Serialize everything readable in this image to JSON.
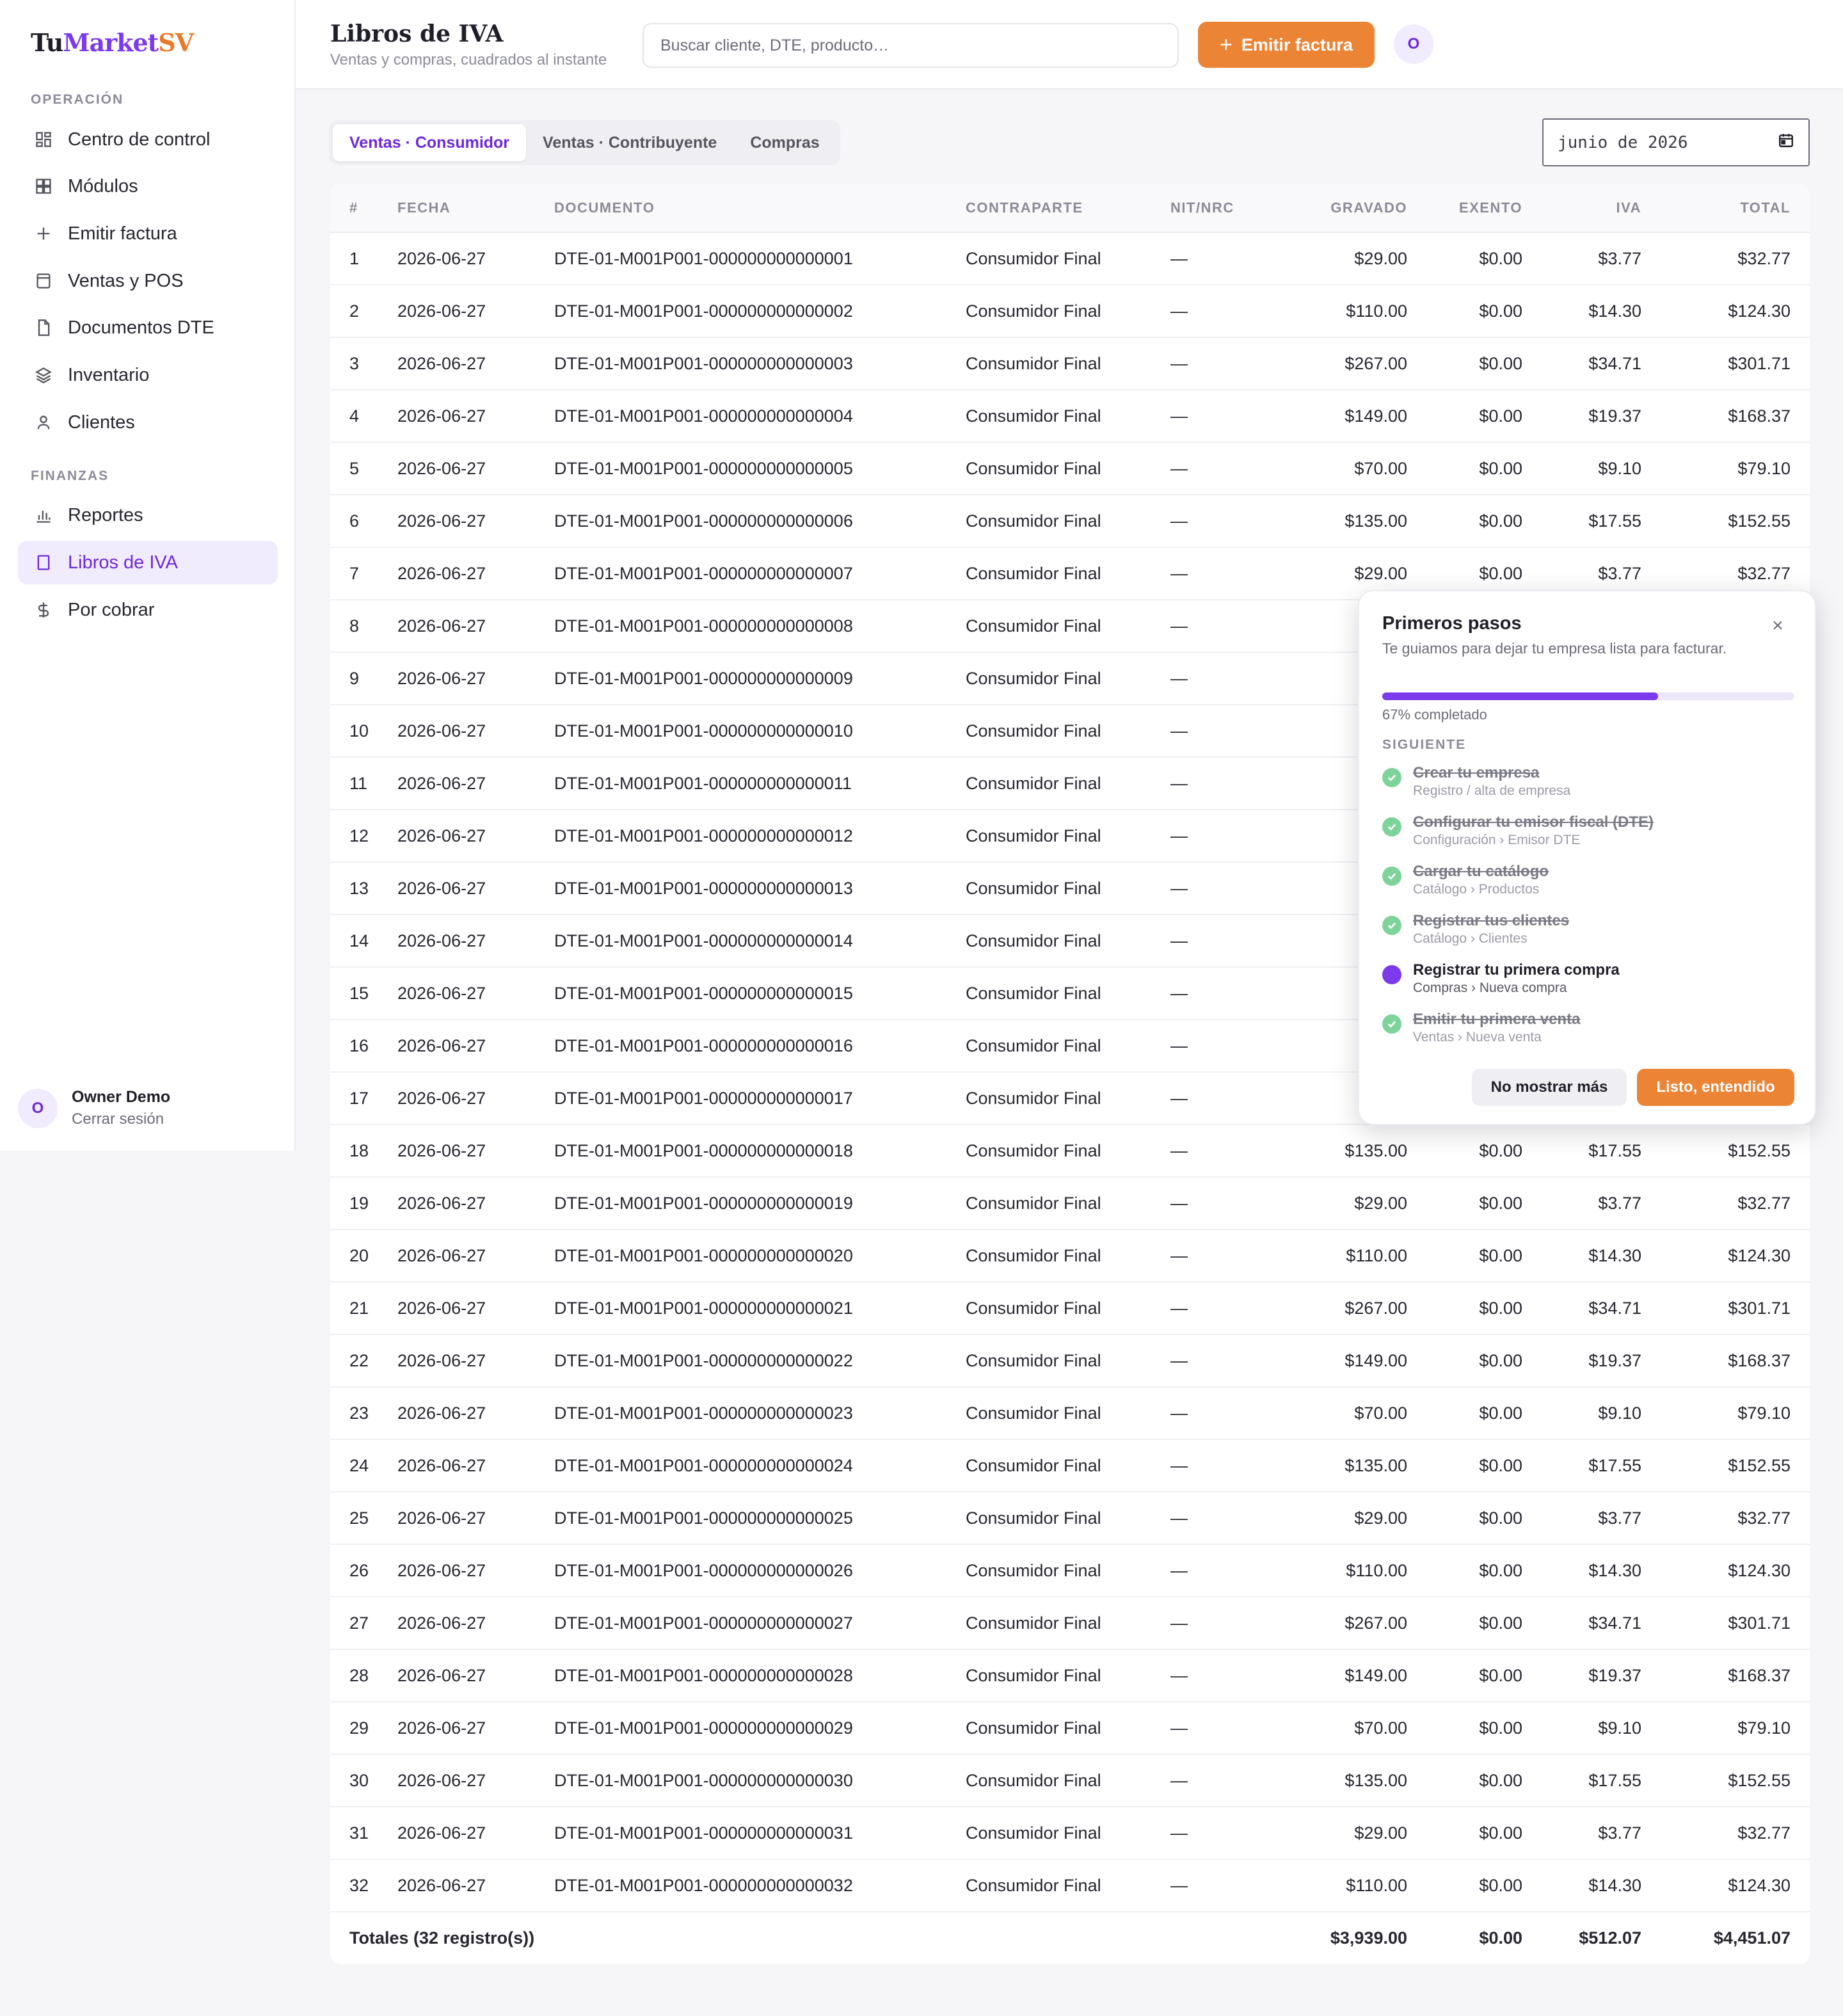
{
  "brand": {
    "part1": "Tu",
    "part2": "Market",
    "part3": "SV"
  },
  "sidebar": {
    "section1": "OPERACIÓN",
    "section2": "FINANZAS",
    "items": [
      {
        "label": "Centro de control",
        "icon": "dashboard-icon"
      },
      {
        "label": "Módulos",
        "icon": "grid-icon"
      },
      {
        "label": "Emitir factura",
        "icon": "plus-icon"
      },
      {
        "label": "Ventas y POS",
        "icon": "register-icon"
      },
      {
        "label": "Documentos DTE",
        "icon": "document-icon"
      },
      {
        "label": "Inventario",
        "icon": "layers-icon"
      },
      {
        "label": "Clientes",
        "icon": "user-icon"
      },
      {
        "label": "Reportes",
        "icon": "bar-chart-icon"
      },
      {
        "label": "Libros de IVA",
        "icon": "book-icon",
        "active": true
      },
      {
        "label": "Por cobrar",
        "icon": "dollar-icon"
      }
    ],
    "user": {
      "initial": "O",
      "name": "Owner Demo",
      "action": "Cerrar sesión"
    }
  },
  "header": {
    "title": "Libros de IVA",
    "subtitle": "Ventas y compras, cuadrados al instante",
    "search_placeholder": "Buscar cliente, DTE, producto…",
    "emit_label": "Emitir factura",
    "avatar_initial": "O"
  },
  "tabs": [
    {
      "label": "Ventas · Consumidor",
      "active": true
    },
    {
      "label": "Ventas · Contribuyente",
      "active": false
    },
    {
      "label": "Compras",
      "active": false
    }
  ],
  "period": "junio de 2026",
  "table": {
    "columns": [
      "#",
      "FECHA",
      "DOCUMENTO",
      "CONTRAPARTE",
      "NIT/NRC",
      "GRAVADO",
      "EXENTO",
      "IVA",
      "TOTAL"
    ],
    "rows": [
      [
        "1",
        "2026-06-27",
        "DTE-01-M001P001-000000000000001",
        "Consumidor Final",
        "—",
        "$29.00",
        "$0.00",
        "$3.77",
        "$32.77"
      ],
      [
        "2",
        "2026-06-27",
        "DTE-01-M001P001-000000000000002",
        "Consumidor Final",
        "—",
        "$110.00",
        "$0.00",
        "$14.30",
        "$124.30"
      ],
      [
        "3",
        "2026-06-27",
        "DTE-01-M001P001-000000000000003",
        "Consumidor Final",
        "—",
        "$267.00",
        "$0.00",
        "$34.71",
        "$301.71"
      ],
      [
        "4",
        "2026-06-27",
        "DTE-01-M001P001-000000000000004",
        "Consumidor Final",
        "—",
        "$149.00",
        "$0.00",
        "$19.37",
        "$168.37"
      ],
      [
        "5",
        "2026-06-27",
        "DTE-01-M001P001-000000000000005",
        "Consumidor Final",
        "—",
        "$70.00",
        "$0.00",
        "$9.10",
        "$79.10"
      ],
      [
        "6",
        "2026-06-27",
        "DTE-01-M001P001-000000000000006",
        "Consumidor Final",
        "—",
        "$135.00",
        "$0.00",
        "$17.55",
        "$152.55"
      ],
      [
        "7",
        "2026-06-27",
        "DTE-01-M001P001-000000000000007",
        "Consumidor Final",
        "—",
        "$29.00",
        "$0.00",
        "$3.77",
        "$32.77"
      ],
      [
        "8",
        "2026-06-27",
        "DTE-01-M001P001-000000000000008",
        "Consumidor Final",
        "—",
        "",
        "",
        "",
        ""
      ],
      [
        "9",
        "2026-06-27",
        "DTE-01-M001P001-000000000000009",
        "Consumidor Final",
        "—",
        "",
        "",
        "",
        ""
      ],
      [
        "10",
        "2026-06-27",
        "DTE-01-M001P001-000000000000010",
        "Consumidor Final",
        "—",
        "",
        "",
        "",
        ""
      ],
      [
        "11",
        "2026-06-27",
        "DTE-01-M001P001-000000000000011",
        "Consumidor Final",
        "—",
        "",
        "",
        "",
        ""
      ],
      [
        "12",
        "2026-06-27",
        "DTE-01-M001P001-000000000000012",
        "Consumidor Final",
        "—",
        "",
        "",
        "",
        ""
      ],
      [
        "13",
        "2026-06-27",
        "DTE-01-M001P001-000000000000013",
        "Consumidor Final",
        "—",
        "",
        "",
        "",
        ""
      ],
      [
        "14",
        "2026-06-27",
        "DTE-01-M001P001-000000000000014",
        "Consumidor Final",
        "—",
        "",
        "",
        "",
        ""
      ],
      [
        "15",
        "2026-06-27",
        "DTE-01-M001P001-000000000000015",
        "Consumidor Final",
        "—",
        "",
        "",
        "",
        ""
      ],
      [
        "16",
        "2026-06-27",
        "DTE-01-M001P001-000000000000016",
        "Consumidor Final",
        "—",
        "",
        "",
        "",
        ""
      ],
      [
        "17",
        "2026-06-27",
        "DTE-01-M001P001-000000000000017",
        "Consumidor Final",
        "—",
        "",
        "",
        "",
        ""
      ],
      [
        "18",
        "2026-06-27",
        "DTE-01-M001P001-000000000000018",
        "Consumidor Final",
        "—",
        "$135.00",
        "$0.00",
        "$17.55",
        "$152.55"
      ],
      [
        "19",
        "2026-06-27",
        "DTE-01-M001P001-000000000000019",
        "Consumidor Final",
        "—",
        "$29.00",
        "$0.00",
        "$3.77",
        "$32.77"
      ],
      [
        "20",
        "2026-06-27",
        "DTE-01-M001P001-000000000000020",
        "Consumidor Final",
        "—",
        "$110.00",
        "$0.00",
        "$14.30",
        "$124.30"
      ],
      [
        "21",
        "2026-06-27",
        "DTE-01-M001P001-000000000000021",
        "Consumidor Final",
        "—",
        "$267.00",
        "$0.00",
        "$34.71",
        "$301.71"
      ],
      [
        "22",
        "2026-06-27",
        "DTE-01-M001P001-000000000000022",
        "Consumidor Final",
        "—",
        "$149.00",
        "$0.00",
        "$19.37",
        "$168.37"
      ],
      [
        "23",
        "2026-06-27",
        "DTE-01-M001P001-000000000000023",
        "Consumidor Final",
        "—",
        "$70.00",
        "$0.00",
        "$9.10",
        "$79.10"
      ],
      [
        "24",
        "2026-06-27",
        "DTE-01-M001P001-000000000000024",
        "Consumidor Final",
        "—",
        "$135.00",
        "$0.00",
        "$17.55",
        "$152.55"
      ],
      [
        "25",
        "2026-06-27",
        "DTE-01-M001P001-000000000000025",
        "Consumidor Final",
        "—",
        "$29.00",
        "$0.00",
        "$3.77",
        "$32.77"
      ],
      [
        "26",
        "2026-06-27",
        "DTE-01-M001P001-000000000000026",
        "Consumidor Final",
        "—",
        "$110.00",
        "$0.00",
        "$14.30",
        "$124.30"
      ],
      [
        "27",
        "2026-06-27",
        "DTE-01-M001P001-000000000000027",
        "Consumidor Final",
        "—",
        "$267.00",
        "$0.00",
        "$34.71",
        "$301.71"
      ],
      [
        "28",
        "2026-06-27",
        "DTE-01-M001P001-000000000000028",
        "Consumidor Final",
        "—",
        "$149.00",
        "$0.00",
        "$19.37",
        "$168.37"
      ],
      [
        "29",
        "2026-06-27",
        "DTE-01-M001P001-000000000000029",
        "Consumidor Final",
        "—",
        "$70.00",
        "$0.00",
        "$9.10",
        "$79.10"
      ],
      [
        "30",
        "2026-06-27",
        "DTE-01-M001P001-000000000000030",
        "Consumidor Final",
        "—",
        "$135.00",
        "$0.00",
        "$17.55",
        "$152.55"
      ],
      [
        "31",
        "2026-06-27",
        "DTE-01-M001P001-000000000000031",
        "Consumidor Final",
        "—",
        "$29.00",
        "$0.00",
        "$3.77",
        "$32.77"
      ],
      [
        "32",
        "2026-06-27",
        "DTE-01-M001P001-000000000000032",
        "Consumidor Final",
        "—",
        "$110.00",
        "$0.00",
        "$14.30",
        "$124.30"
      ]
    ],
    "totals": {
      "label": "Totales (32 registro(s))",
      "gravado": "$3,939.00",
      "exento": "$0.00",
      "iva": "$512.07",
      "total": "$4,451.07"
    }
  },
  "onboarding": {
    "title": "Primeros pasos",
    "subtitle": "Te guiamos para dejar tu empresa lista para facturar.",
    "progress": 0.67,
    "progress_label": "67% completado",
    "next_label": "SIGUIENTE",
    "steps": [
      {
        "title": "Crear tu empresa",
        "sub": "Registro / alta de empresa",
        "done": true
      },
      {
        "title": "Configurar tu emisor fiscal (DTE)",
        "sub": "Configuración › Emisor DTE",
        "done": true
      },
      {
        "title": "Cargar tu catálogo",
        "sub": "Catálogo › Productos",
        "done": true
      },
      {
        "title": "Registrar tus clientes",
        "sub": "Catálogo › Clientes",
        "done": true
      },
      {
        "title": "Registrar tu primera compra",
        "sub": "Compras › Nueva compra",
        "done": false
      },
      {
        "title": "Emitir tu primera venta",
        "sub": "Ventas › Nueva venta",
        "done": true
      }
    ],
    "dismiss_label": "No mostrar más",
    "ok_label": "Listo, entendido"
  },
  "colors": {
    "accent": "#7c3aed",
    "brand_orange": "#ec8435",
    "done_green": "#7dd39a"
  }
}
